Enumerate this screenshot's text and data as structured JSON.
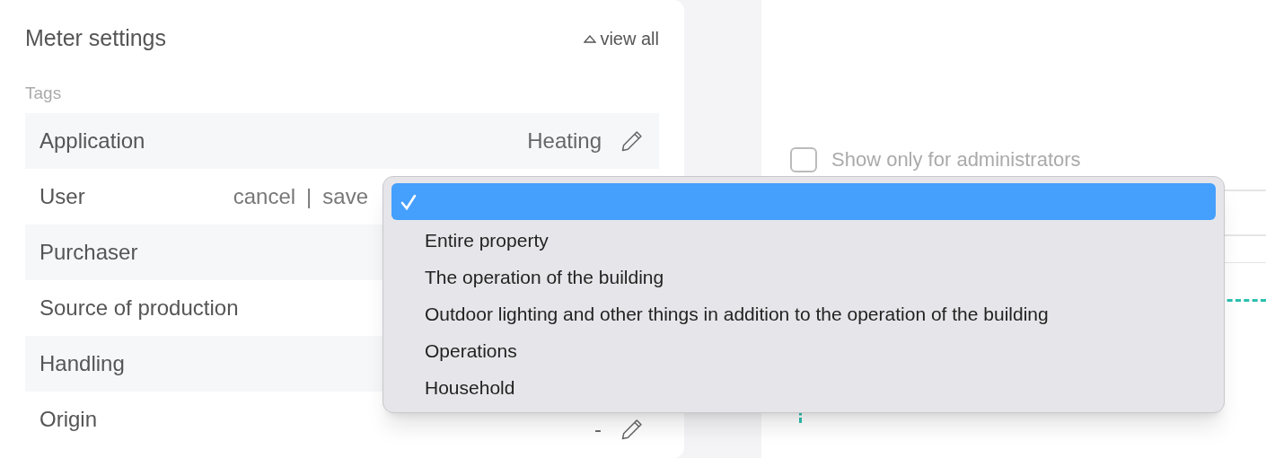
{
  "panel": {
    "title": "Meter settings",
    "view_all": "view all",
    "section": "Tags",
    "rows": [
      {
        "label": "Application",
        "kind": "value",
        "value": "Heating"
      },
      {
        "label": "User",
        "kind": "editing",
        "cancel": "cancel",
        "separator": "|",
        "save": "save"
      },
      {
        "label": "Purchaser",
        "kind": "value"
      },
      {
        "label": "Source of production",
        "kind": "value"
      },
      {
        "label": "Handling",
        "kind": "value"
      },
      {
        "label": "Origin",
        "kind": "value",
        "value": "-"
      }
    ]
  },
  "admin_option": {
    "label": "Show only for administrators",
    "checked": false
  },
  "dropdown": {
    "options": [
      {
        "selected": true
      },
      {
        "label": "Entire property",
        "selected": false
      },
      {
        "label": "The operation of the building",
        "selected": false
      },
      {
        "label": "Outdoor lighting and other things in addition to the operation of the building",
        "selected": false
      },
      {
        "label": "Operations",
        "selected": false
      },
      {
        "label": "Household",
        "selected": false
      }
    ]
  }
}
